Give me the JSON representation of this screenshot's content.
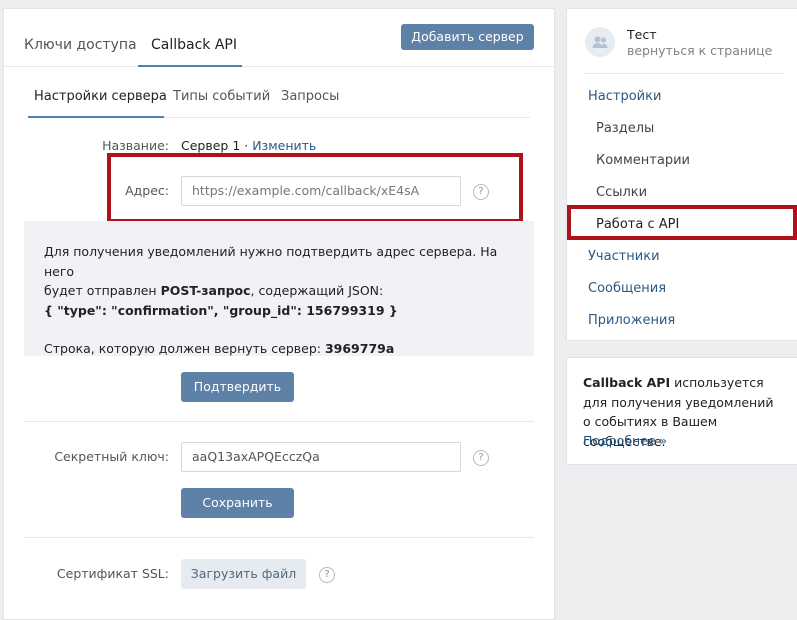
{
  "header": {
    "tabs": [
      {
        "label": "Ключи доступа"
      },
      {
        "label": "Callback API"
      }
    ],
    "add_server_button": "Добавить сервер"
  },
  "subtabs": [
    {
      "label": "Настройки сервера"
    },
    {
      "label": "Типы событий"
    },
    {
      "label": "Запросы"
    }
  ],
  "server": {
    "name_label": "Название:",
    "name_value": "Сервер 1",
    "name_sep": " · ",
    "edit_link": "Изменить",
    "address_label": "Адрес:",
    "address_placeholder": "https://example.com/callback/xE4sA",
    "help": "?"
  },
  "info": {
    "line1": "Для получения уведомлений нужно подтвердить адрес сервера. На него",
    "line2_pre": "будет отправлен ",
    "line2_bold": "POST-запрос",
    "line2_post": ", содержащий JSON:",
    "json_line": "{ \"type\": \"confirmation\", \"group_id\": 156799319 }",
    "return_pre": "Строка, которую должен вернуть сервер: ",
    "return_value": "3969779a"
  },
  "confirm_button": "Подтвердить",
  "secret": {
    "label": "Секретный ключ:",
    "value": "aaQ13axAPQEcczQa",
    "save_button": "Сохранить"
  },
  "ssl": {
    "label": "Сертификат SSL:",
    "upload_button": "Загрузить файл"
  },
  "sidebar": {
    "group_name": "Тест",
    "back_link": "вернуться к странице",
    "items": [
      {
        "label": "Настройки"
      },
      {
        "label": "Разделы"
      },
      {
        "label": "Комментарии"
      },
      {
        "label": "Ссылки"
      },
      {
        "label": "Работа с API"
      },
      {
        "label": "Участники"
      },
      {
        "label": "Сообщения"
      },
      {
        "label": "Приложения"
      }
    ]
  },
  "side_info": {
    "bold": "Callback API",
    "text": " используется для получения уведомлений о событиях в Вашем сообществе.",
    "more_link": "Подробнее »"
  },
  "colors": {
    "accent": "#5181b8",
    "button": "#5e81a8",
    "highlight_box": "#b0121b",
    "link": "#2a5885"
  }
}
